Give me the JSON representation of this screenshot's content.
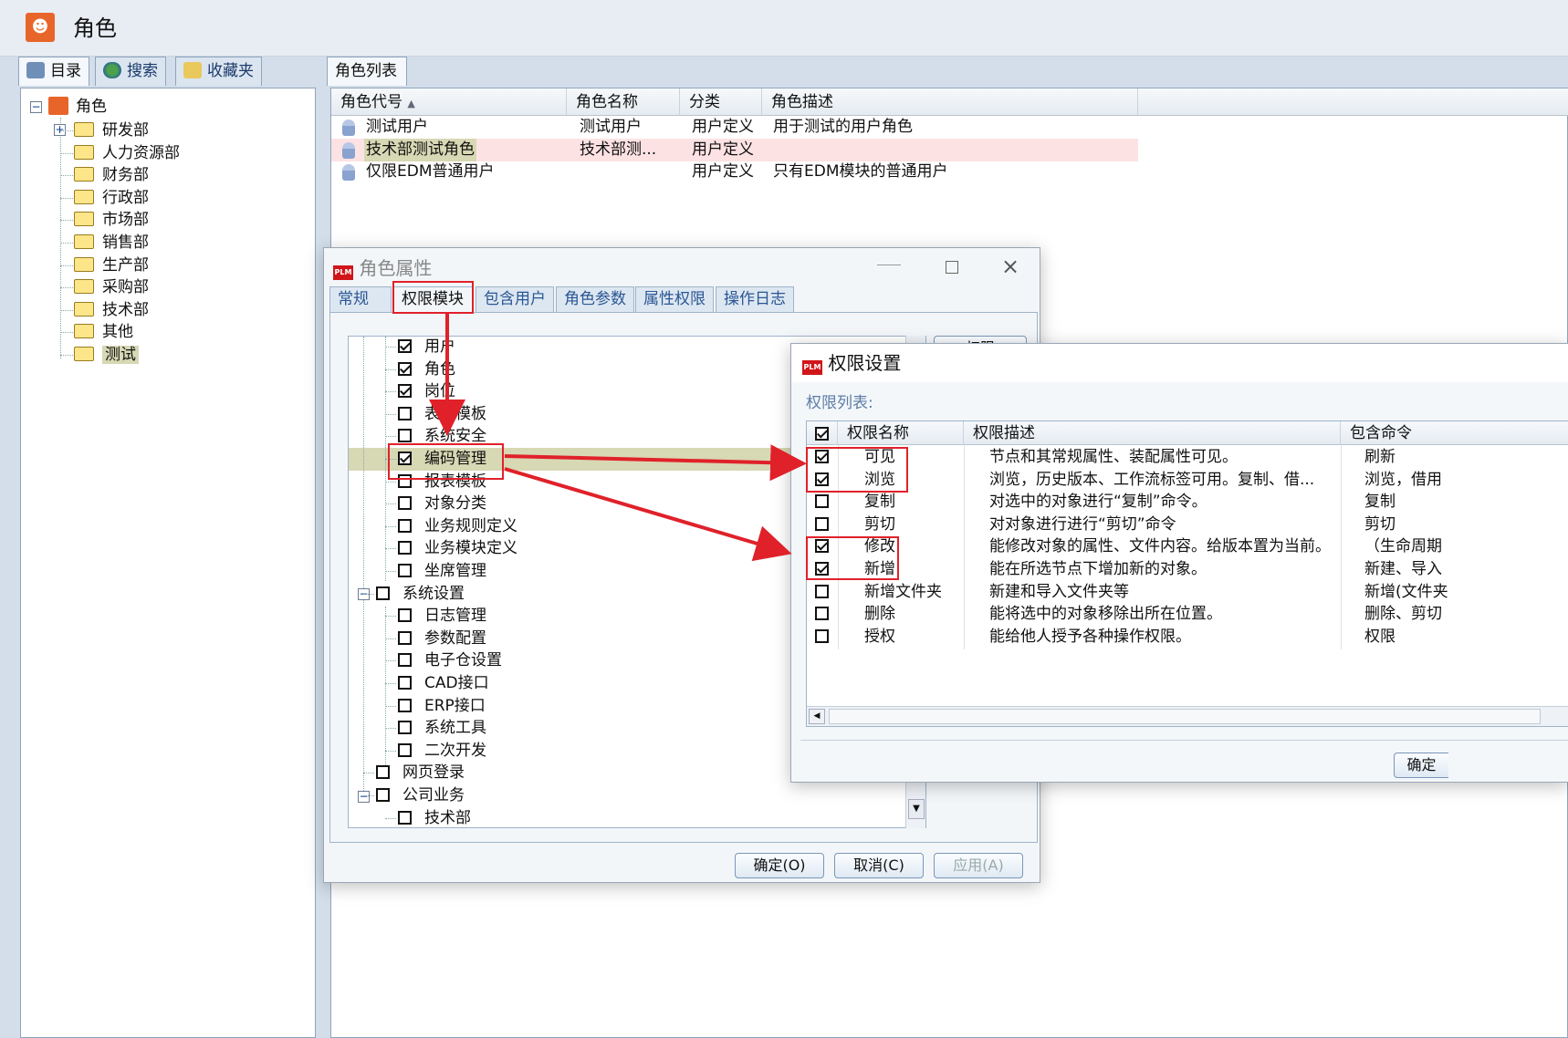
{
  "window": {
    "title": "角色"
  },
  "left_tabs": [
    {
      "label": "目录"
    },
    {
      "label": "搜索"
    },
    {
      "label": "收藏夹"
    }
  ],
  "left_tree": {
    "root": "角色",
    "items": [
      "研发部",
      "人力资源部",
      "财务部",
      "行政部",
      "市场部",
      "销售部",
      "生产部",
      "采购部",
      "技术部",
      "其他",
      "测试"
    ]
  },
  "right_tab": {
    "label": "角色列表"
  },
  "role_list": {
    "columns": [
      "角色代号",
      "角色名称",
      "分类",
      "角色描述"
    ],
    "rows": [
      {
        "code": "测试用户",
        "name": "测试用户",
        "category": "用户定义",
        "desc": "用于测试的用户角色"
      },
      {
        "code": "技术部测试角色",
        "name": "技术部测...",
        "category": "用户定义",
        "desc": ""
      },
      {
        "code": "仅限EDM普通用户",
        "name": "",
        "category": "用户定义",
        "desc": "只有EDM模块的普通用户"
      }
    ]
  },
  "role_dialog": {
    "title": "角色属性",
    "tabs": [
      "常规",
      "权限模块",
      "包含用户",
      "角色参数",
      "属性权限",
      "操作日志"
    ],
    "top_button": "权限",
    "tree": [
      {
        "label": "用户",
        "checked": true
      },
      {
        "label": "角色",
        "checked": true
      },
      {
        "label": "岗位",
        "checked": true
      },
      {
        "label": "表单模板",
        "checked": false
      },
      {
        "label": "系统安全",
        "checked": false
      },
      {
        "label": "编码管理",
        "checked": true
      },
      {
        "label": "报表模板",
        "checked": false
      },
      {
        "label": "对象分类",
        "checked": false
      },
      {
        "label": "业务规则定义",
        "checked": false
      },
      {
        "label": "业务模块定义",
        "checked": false
      },
      {
        "label": "坐席管理",
        "checked": false
      },
      {
        "label": "系统设置",
        "checked": false
      },
      {
        "label": "日志管理",
        "checked": false
      },
      {
        "label": "参数配置",
        "checked": false
      },
      {
        "label": "电子仓设置",
        "checked": false
      },
      {
        "label": "CAD接口",
        "checked": false
      },
      {
        "label": "ERP接口",
        "checked": false
      },
      {
        "label": "系统工具",
        "checked": false
      },
      {
        "label": "二次开发",
        "checked": false
      },
      {
        "label": "网页登录",
        "checked": false
      },
      {
        "label": "公司业务",
        "checked": false
      },
      {
        "label": "技术部",
        "checked": false
      }
    ],
    "buttons": {
      "ok": "确定(O)",
      "cancel": "取消(C)",
      "apply": "应用(A)"
    }
  },
  "perm_dialog": {
    "title": "权限设置",
    "list_label": "权限列表:",
    "columns": [
      "权限名称",
      "权限描述",
      "包含命令"
    ],
    "rows": [
      {
        "name": "可见",
        "desc": "节点和其常规属性、装配属性可见。",
        "cmd": "刷新",
        "checked": true
      },
      {
        "name": "浏览",
        "desc": "浏览，历史版本、工作流标签可用。复制、借...",
        "cmd": "浏览，借用",
        "checked": true
      },
      {
        "name": "复制",
        "desc": "对选中的对象进行“复制”命令。",
        "cmd": "复制",
        "checked": false
      },
      {
        "name": "剪切",
        "desc": "对对象进行进行“剪切”命令",
        "cmd": "剪切",
        "checked": false
      },
      {
        "name": "修改",
        "desc": "能修改对象的属性、文件内容。给版本置为当前。",
        "cmd": "（生命周期",
        "checked": true
      },
      {
        "name": "新增",
        "desc": "能在所选节点下增加新的对象。",
        "cmd": "新建、导入",
        "checked": true
      },
      {
        "name": "新增文件夹",
        "desc": "新建和导入文件夹等",
        "cmd": "新增(文件夹",
        "checked": false
      },
      {
        "name": "删除",
        "desc": "能将选中的对象移除出所在位置。",
        "cmd": "删除、剪切",
        "checked": false
      },
      {
        "name": "授权",
        "desc": "能给他人授予各种操作权限。",
        "cmd": "权限",
        "checked": false
      }
    ],
    "ok_button": "确定"
  },
  "colors": {
    "accent_red": "#e0212a",
    "selection_pink": "#fde2e4",
    "selection_olive": "#d7d8b4"
  }
}
